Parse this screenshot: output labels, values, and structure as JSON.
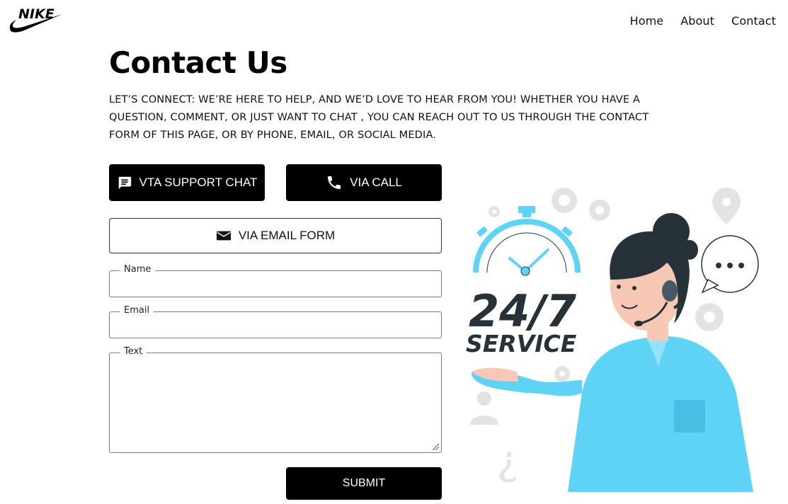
{
  "brand": {
    "logo_text": "NIKE"
  },
  "nav": {
    "items": [
      "Home",
      "About",
      "Contact"
    ]
  },
  "page": {
    "title": "Contact Us",
    "intro_line1": "LET’S CONNECT: WE’RE HERE TO HELP, AND WE’D LOVE TO HEAR FROM YOU! WHETHER YOU HAVE A",
    "intro_line2": "QUESTION, COMMENT, OR JUST WANT TO CHAT , YOU CAN REACH OUT TO US THROUGH THE CONTACT",
    "intro_line3": "FORM OF THIS PAGE, OR BY PHONE, EMAIL, OR SOCIAL MEDIA."
  },
  "buttons": {
    "support_chat": "VTA SUPPORT CHAT",
    "call": "VIA CALL",
    "email_form": "VIA EMAIL FORM",
    "submit": "SUBMIT"
  },
  "form": {
    "name_label": "Name",
    "email_label": "Email",
    "text_label": "Text",
    "name_value": "",
    "email_value": "",
    "text_value": ""
  },
  "illustration": {
    "big_text": "24/7",
    "sub_text": "SERVICE"
  },
  "colors": {
    "accent_blue": "#5fd3f6",
    "dark": "#263238",
    "button_bg": "#000000"
  },
  "icons": [
    "message-icon",
    "phone-icon",
    "mail-icon",
    "resize-grip-icon"
  ]
}
